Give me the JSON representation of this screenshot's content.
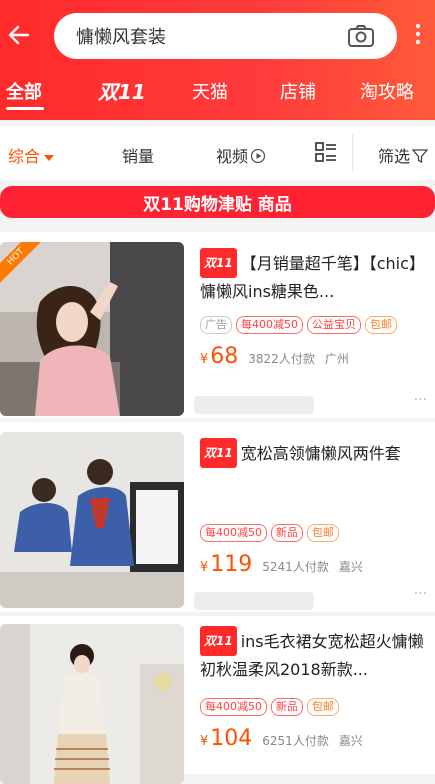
{
  "search": {
    "query": "慵懒风套装"
  },
  "tabs": [
    "全部",
    "双11",
    "天猫",
    "店铺",
    "淘攻略"
  ],
  "sort": {
    "comprehensive": "综合",
    "sales": "销量",
    "video": "视频",
    "filter": "筛选"
  },
  "banner": {
    "text": "双11购物津贴 商品"
  },
  "badge": {
    "d11": "双11",
    "hot": "HOT"
  },
  "items": [
    {
      "title": "【月销量超千笔】【chic】慵懒风ins糖果色...",
      "tags": [
        "广告",
        "每400减50",
        "公益宝贝",
        "包邮"
      ],
      "price": "68",
      "sold": "3822人付款",
      "location": "广州"
    },
    {
      "title": "宽松高领慵懒风两件套",
      "tags": [
        "每400减50",
        "新品",
        "包邮"
      ],
      "price": "119",
      "sold": "5241人付款",
      "location": "嘉兴"
    },
    {
      "title": "ins毛衣裙女宽松超火慵懒初秋温柔风2018新款...",
      "tags": [
        "每400减50",
        "新品",
        "包邮"
      ],
      "price": "104",
      "sold": "6251人付款",
      "location": "嘉兴"
    }
  ],
  "currency": "¥",
  "colors": {
    "brand": "#ff2a2a",
    "price": "#ff5000"
  }
}
